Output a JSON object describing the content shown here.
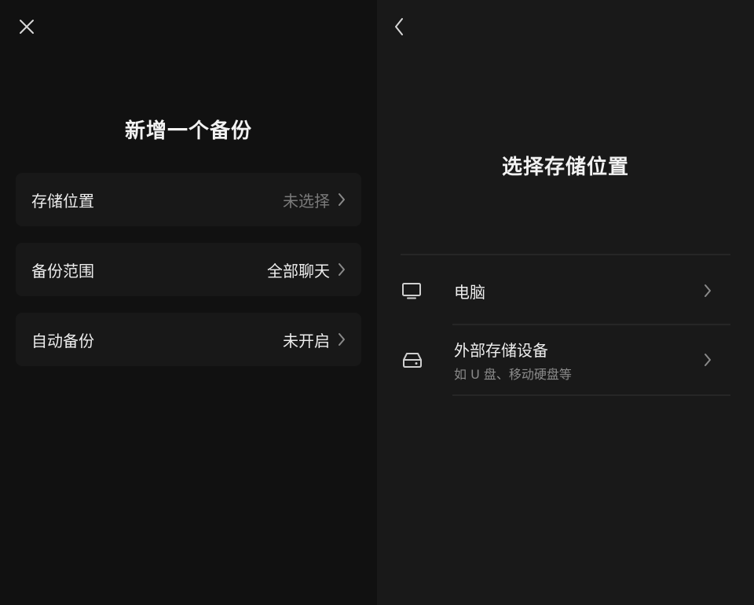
{
  "left": {
    "title": "新增一个备份",
    "items": [
      {
        "label": "存储位置",
        "value": "未选择"
      },
      {
        "label": "备份范围",
        "value": "全部聊天"
      },
      {
        "label": "自动备份",
        "value": "未开启"
      }
    ]
  },
  "right": {
    "title": "选择存储位置",
    "options": [
      {
        "title": "电脑",
        "icon": "monitor-icon"
      },
      {
        "title": "外部存储设备",
        "subtitle": "如 U 盘、移动硬盘等",
        "icon": "hard-drive-icon"
      }
    ]
  },
  "colors": {
    "background": "#111111",
    "right_background": "#191919",
    "card": "#181818",
    "text": "#ededed",
    "muted": "#7a7a7a"
  }
}
